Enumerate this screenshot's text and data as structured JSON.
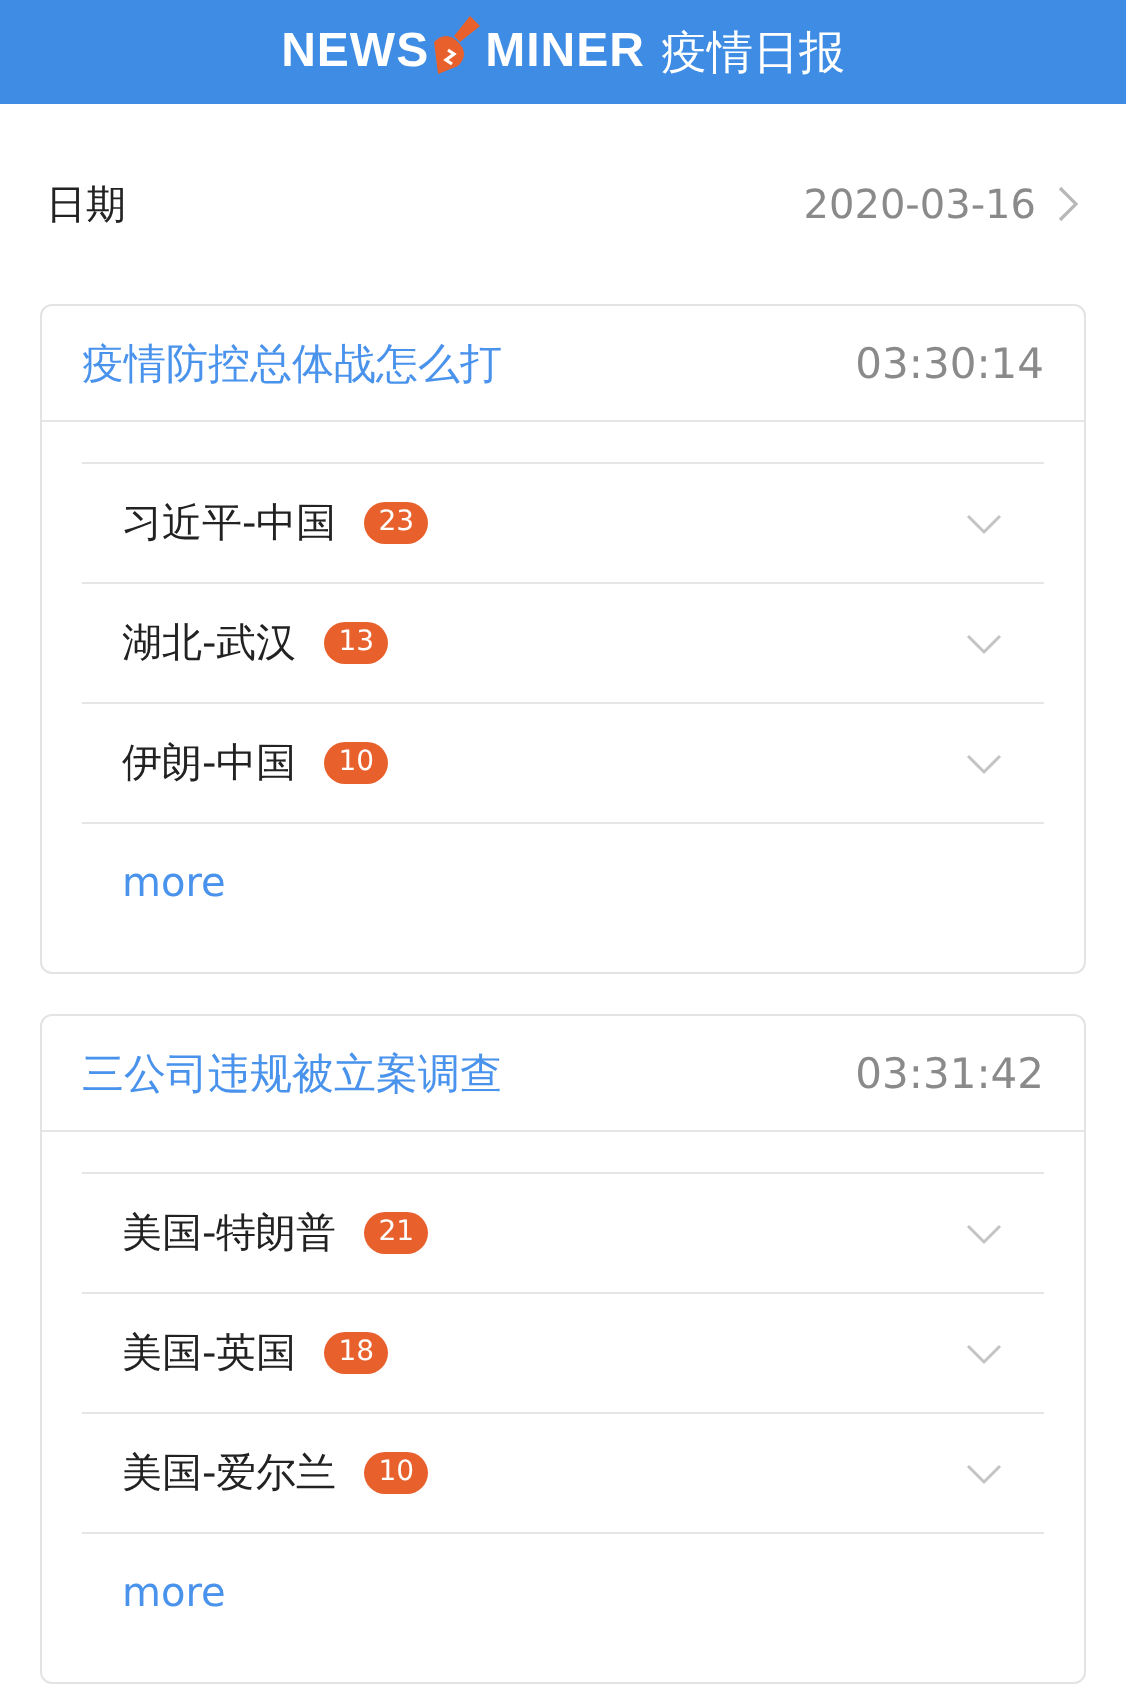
{
  "header": {
    "logo_left": "NEWS",
    "logo_right": "MINER",
    "title": "疫情日报"
  },
  "date_row": {
    "label": "日期",
    "value": "2020-03-16"
  },
  "cards": [
    {
      "title": "疫情防控总体战怎么打",
      "time": "03:30:14",
      "items": [
        {
          "name": "习近平-中国",
          "count": "23",
          "expanded": false
        },
        {
          "name": "湖北-武汉",
          "count": "13",
          "expanded": false
        },
        {
          "name": "伊朗-中国",
          "count": "10",
          "expanded": false
        }
      ],
      "more": "more"
    },
    {
      "title": "三公司违规被立案调查",
      "time": "03:31:42",
      "items": [
        {
          "name": "美国-特朗普",
          "count": "21",
          "expanded": false
        },
        {
          "name": "美国-英国",
          "count": "18",
          "expanded": false
        },
        {
          "name": "美国-爱尔兰",
          "count": "10",
          "expanded": false
        }
      ],
      "more": "more"
    }
  ]
}
